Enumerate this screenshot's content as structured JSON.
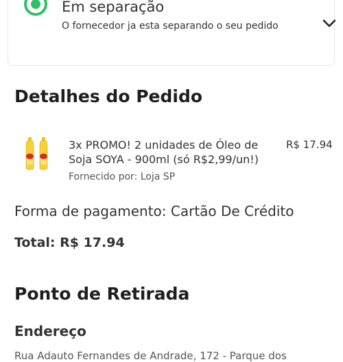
{
  "status": {
    "title": "Em separação",
    "subtitle": "O fornecedor ja esta separando o seu pedido"
  },
  "order_details": {
    "title": "Detalhes do Pedido",
    "item": {
      "description": "3x PROMO! 2 unidades de Óleo de Soja SOYA - 900ml (só R$2,99/un!)",
      "price": "R$ 17.94",
      "supplier": "Fornecido por: Loja SP"
    },
    "payment": "Forma de pagamento: Cartão De Crédito",
    "total": "Total: R$ 17.94"
  },
  "pickup": {
    "title": "Ponto de Retirada",
    "address_label": "Endereço",
    "address_value": "Rua Adauto Fernandes de Andrade, 172 - Parque dos"
  },
  "colors": {
    "status_green": "#2fbf6a",
    "oil_yellow": "#f2c200",
    "label_red": "#d62828"
  }
}
